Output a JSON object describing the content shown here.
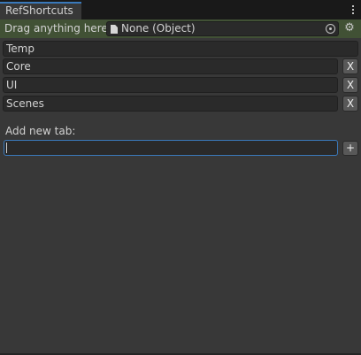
{
  "window": {
    "tab_title": "RefShortcuts"
  },
  "drag_area": {
    "label": "Drag anything here:",
    "object_field_value": "None (Object)"
  },
  "tabs": [
    {
      "label": "Temp",
      "removable": false
    },
    {
      "label": "Core",
      "removable": true,
      "remove_label": "X"
    },
    {
      "label": "UI",
      "removable": true,
      "remove_label": "X"
    },
    {
      "label": "Scenes",
      "removable": true,
      "remove_label": "X"
    }
  ],
  "add_tab": {
    "label": "Add new tab:",
    "input_value": "",
    "add_button_label": "+"
  },
  "icons": {
    "object": "document-icon",
    "picker": "object-picker-icon",
    "settings": "gear-icon",
    "menu": "kebab-menu-icon"
  },
  "colors": {
    "background": "#383838",
    "drag_area": "#415135",
    "accent": "#3a79bb",
    "field": "#2a2a2a"
  }
}
